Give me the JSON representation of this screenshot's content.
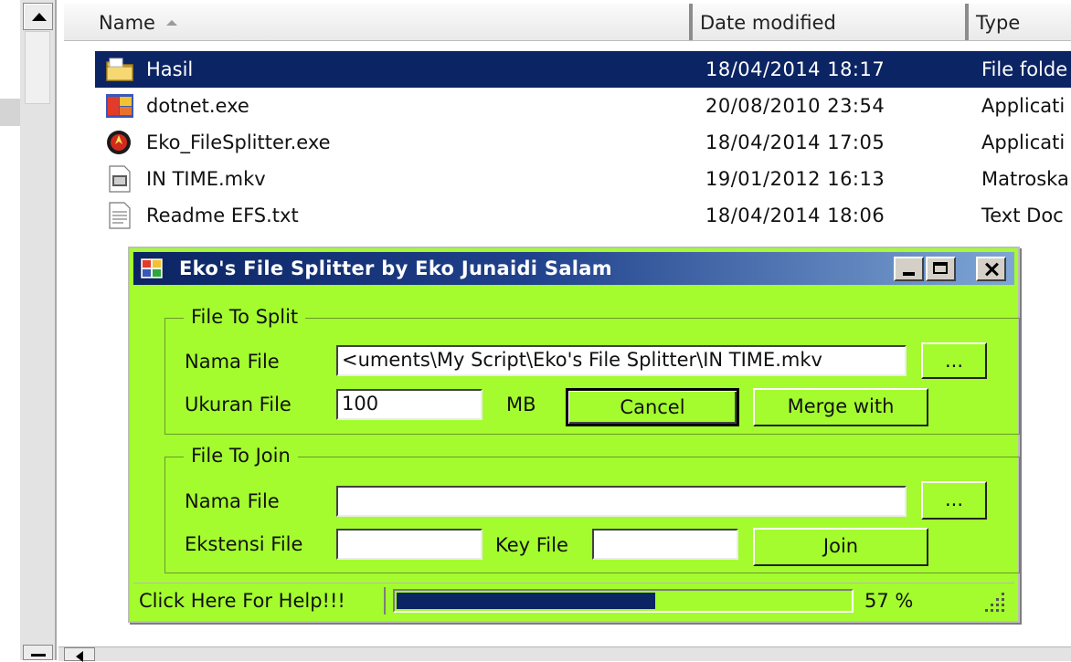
{
  "explorer": {
    "columns": {
      "name": "Name",
      "date": "Date modified",
      "type": "Type"
    },
    "rows": [
      {
        "name": "Hasil",
        "date": "18/04/2014 18:17",
        "type": "File folde",
        "icon": "folder-icon",
        "selected": true
      },
      {
        "name": "dotnet.exe",
        "date": "20/08/2010 23:54",
        "type": "Applicati",
        "icon": "installer-icon",
        "selected": false
      },
      {
        "name": "Eko_FileSplitter.exe",
        "date": "18/04/2014 17:05",
        "type": "Applicati",
        "icon": "app-icon",
        "selected": false
      },
      {
        "name": "IN TIME.mkv",
        "date": "19/01/2012 16:13",
        "type": "Matroska",
        "icon": "video-file-icon",
        "selected": false
      },
      {
        "name": "Readme EFS.txt",
        "date": "18/04/2014 18:06",
        "type": "Text Doc",
        "icon": "text-file-icon",
        "selected": false
      }
    ]
  },
  "dialog": {
    "title": "Eko's File Splitter by Eko Junaidi Salam",
    "split": {
      "legend": "File To Split",
      "file_label": "Nama File",
      "file_value": "<uments\\My Script\\Eko's File Splitter\\IN TIME.mkv",
      "browse_label": "...",
      "size_label": "Ukuran File",
      "size_value": "100",
      "size_unit": "MB",
      "cancel_label": "Cancel",
      "merge_label": "Merge with"
    },
    "join": {
      "legend": "File To Join",
      "file_label": "Nama File",
      "file_value": "",
      "browse_label": "...",
      "ext_label": "Ekstensi File",
      "ext_value": "",
      "key_label": "Key File",
      "key_value": "",
      "join_label": "Join"
    },
    "status": {
      "help": "Click Here For Help!!!",
      "progress": 0.57,
      "percent_text": "57 %"
    }
  },
  "colors": {
    "dialog_bg": "#a4fc2e",
    "selection": "#0b2463",
    "progress_fill": "#0b2463"
  }
}
